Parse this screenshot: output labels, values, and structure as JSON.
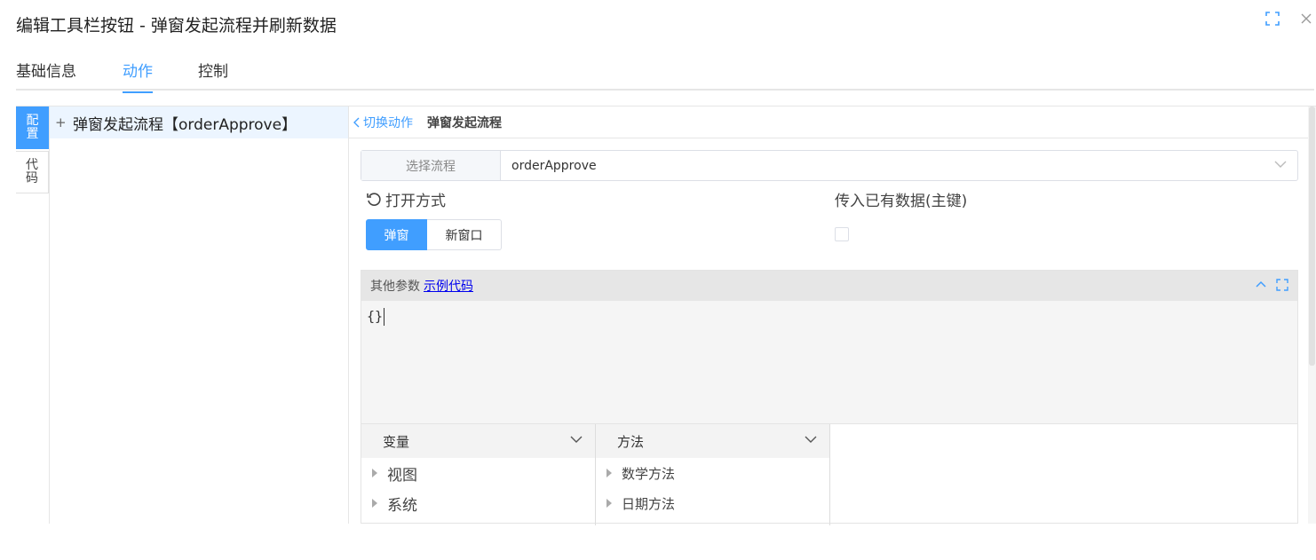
{
  "dialog": {
    "title": "编辑工具栏按钮 - 弹窗发起流程并刷新数据"
  },
  "tabs": [
    {
      "label": "基础信息"
    },
    {
      "label": "动作"
    },
    {
      "label": "控制"
    }
  ],
  "side_tabs": {
    "config": "配置",
    "code": "代码"
  },
  "actions": [
    {
      "prefix": "+",
      "label": "弹窗发起流程【orderApprove】"
    }
  ],
  "breadcrumb": {
    "back_label": "切换动作",
    "current": "弹窗发起流程"
  },
  "process_select": {
    "label": "选择流程",
    "value": "orderApprove"
  },
  "open_mode": {
    "label": "打开方式",
    "options": [
      "弹窗",
      "新窗口"
    ],
    "selected": "弹窗"
  },
  "pass_data": {
    "label": "传入已有数据(主键)",
    "checked": false
  },
  "params": {
    "label": "其他参数",
    "example_link": "示例代码",
    "code": "{}"
  },
  "helpers": {
    "variables": {
      "title": "变量",
      "items": [
        "视图",
        "系统"
      ]
    },
    "methods": {
      "title": "方法",
      "items": [
        "数学方法",
        "日期方法"
      ]
    }
  },
  "colors": {
    "accent": "#409eff",
    "link": "#0000ee"
  }
}
